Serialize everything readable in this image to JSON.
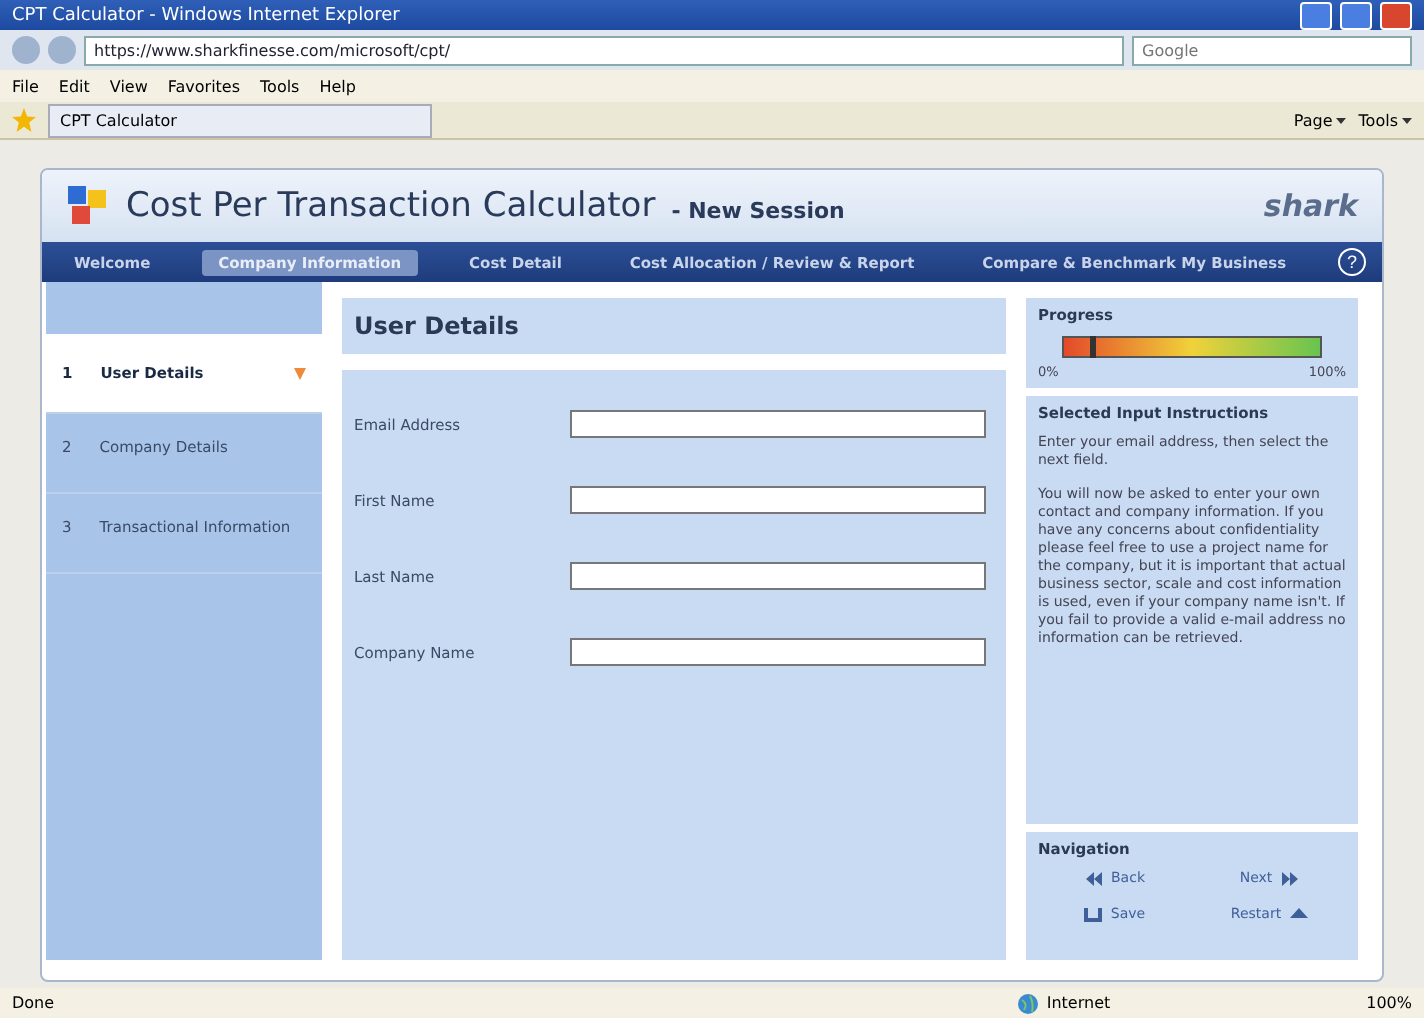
{
  "window": {
    "title": "CPT Calculator - Windows Internet Explorer"
  },
  "address_bar": {
    "url": "https://www.sharkfinesse.com/microsoft/cpt/",
    "search_placeholder": "Google"
  },
  "menu": [
    "File",
    "Edit",
    "View",
    "Favorites",
    "Tools",
    "Help"
  ],
  "browser_tab": {
    "label": "CPT Calculator"
  },
  "command_bar": [
    "Page",
    "Tools"
  ],
  "app": {
    "title": "Cost Per Transaction Calculator",
    "subtitle": "- New Session",
    "logo": "shark",
    "nav": [
      {
        "label": "Welcome",
        "selected": false
      },
      {
        "label": "Company Information",
        "selected": true
      },
      {
        "label": "Cost Detail",
        "selected": false
      },
      {
        "label": "Cost Allocation / Review & Report",
        "selected": false
      },
      {
        "label": "Compare & Benchmark My Business",
        "selected": false
      }
    ],
    "help": "?",
    "steps": [
      {
        "number": "1",
        "label": "User Details",
        "selected": true
      },
      {
        "number": "2",
        "label": "Company Details",
        "selected": false
      },
      {
        "number": "3",
        "label": "Transactional Information",
        "selected": false
      }
    ],
    "form": {
      "title": "User Details",
      "fields": [
        {
          "label": "Email Address"
        },
        {
          "label": "First Name"
        },
        {
          "label": "Last Name"
        },
        {
          "label": "Company Name"
        }
      ]
    },
    "progress": {
      "title": "Progress",
      "level": 0.1,
      "min_label": "0%",
      "max_label": "100%"
    },
    "instructions": {
      "title": "Selected Input Instructions",
      "paragraphs": [
        "Enter your email address, then select the next field.",
        "You will now be asked to enter your own contact and company information. If you have any concerns about confidentiality please feel free to use a project name for the company, but it is important that actual business sector, scale and cost information is used, even if your company name isn't. If you fail to provide a valid e-mail address no information can be retrieved."
      ]
    },
    "navigation": {
      "title": "Navigation",
      "buttons": [
        {
          "label": "Back",
          "kind": "back"
        },
        {
          "label": "Next",
          "kind": "next"
        },
        {
          "label": "Save",
          "kind": "save"
        },
        {
          "label": "Restart",
          "kind": "restart"
        }
      ]
    }
  },
  "status_bar": {
    "text": "Done",
    "zone": "Internet",
    "zoom": "100%"
  }
}
